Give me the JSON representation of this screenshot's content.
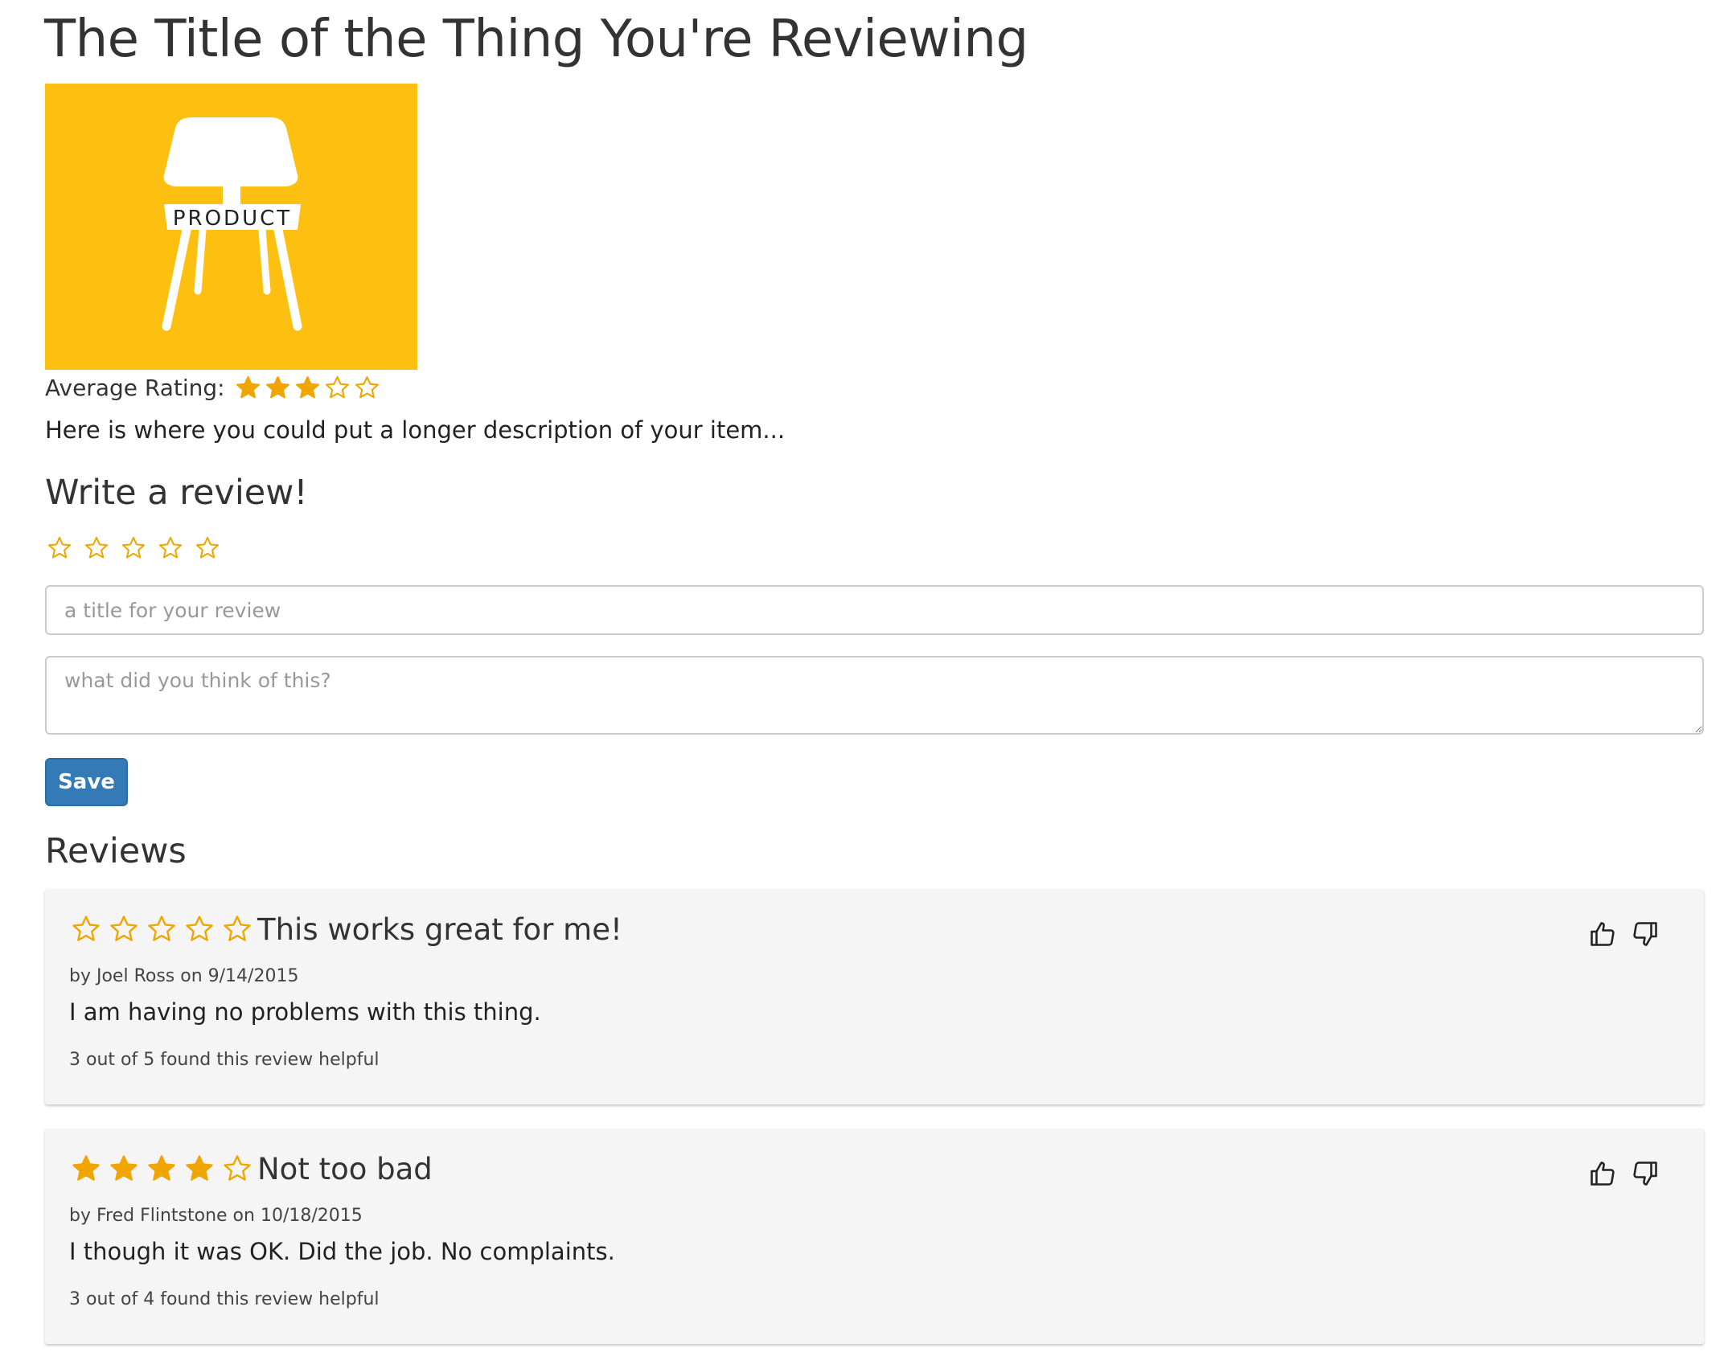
{
  "item": {
    "title": "The Title of the Thing You're Reviewing",
    "image_label": "PRODUCT",
    "average_rating_label": "Average Rating:",
    "average_rating": 3,
    "max_rating": 5,
    "description": "Here is where you could put a longer description of your item..."
  },
  "write_review": {
    "heading": "Write a review!",
    "rating": 0,
    "title_placeholder": "a title for your review",
    "title_value": "",
    "body_placeholder": "what did you think of this?",
    "body_value": "",
    "save_label": "Save"
  },
  "reviews_section": {
    "heading": "Reviews",
    "reviews": [
      {
        "rating": 0,
        "title": "This works great for me!",
        "byline": "by Joel Ross on 9/14/2015",
        "body": "I am having no problems with this thing.",
        "helpful": "3 out of 5 found this review helpful"
      },
      {
        "rating": 4,
        "title": "Not too bad",
        "byline": "by Fred Flintstone on 10/18/2015",
        "body": "I though it was OK. Did the job. No complaints.",
        "helpful": "3 out of 4 found this review helpful"
      }
    ]
  },
  "colors": {
    "star": "#f0a500",
    "image_background": "#fdc010",
    "primary_button": "#337ab7",
    "card_background": "#f5f5f5"
  },
  "icons": {
    "star_filled": "star-filled-icon",
    "star_empty": "star-empty-icon",
    "thumbs_up": "thumbs-up-icon",
    "thumbs_down": "thumbs-down-icon"
  }
}
